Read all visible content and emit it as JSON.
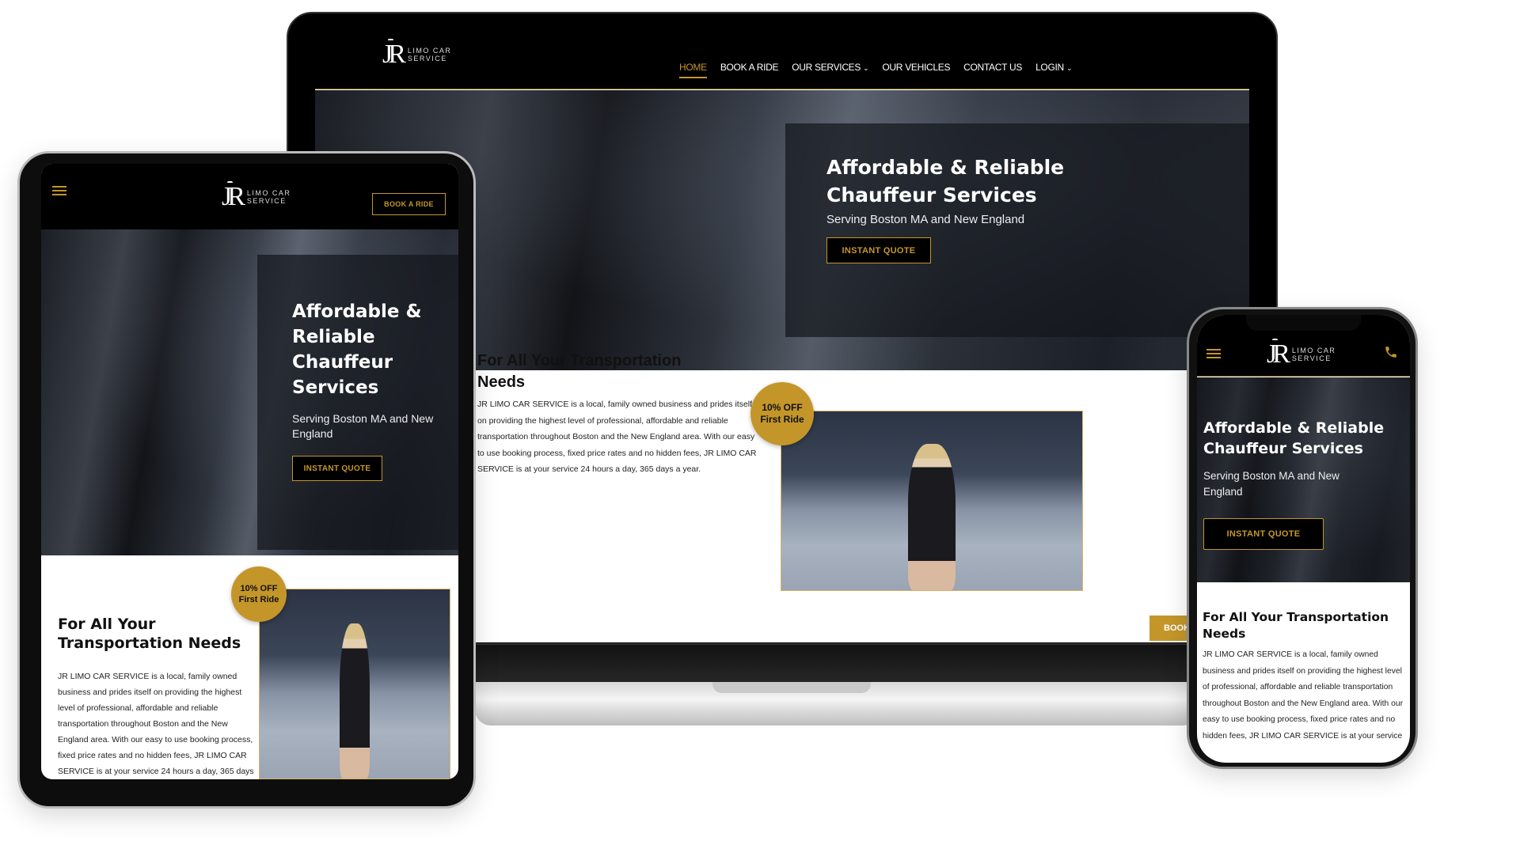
{
  "brand": {
    "initials": "JR",
    "line1": "LIMO CAR",
    "line2": "SERVICE"
  },
  "colors": {
    "accent": "#c4962a",
    "nav_bg": "#000000",
    "text": "#111111"
  },
  "desktop": {
    "nav": [
      {
        "label": "HOME",
        "active": true
      },
      {
        "label": "BOOK A RIDE"
      },
      {
        "label": "OUR SERVICES",
        "dropdown": true
      },
      {
        "label": "OUR VEHICLES"
      },
      {
        "label": "CONTACT US"
      },
      {
        "label": "LOGIN",
        "dropdown": true
      }
    ],
    "chevron": "⌄",
    "book_button": "BOOK"
  },
  "hero": {
    "title_line1": "Affordable & Reliable",
    "title_line2": "Chauffeur Services",
    "tablet_title": [
      "Affordable &",
      "Reliable",
      "Chauffeur",
      "Services"
    ],
    "subtitle": "Serving Boston MA and New England",
    "button": "INSTANT QUOTE"
  },
  "about": {
    "heading": "For All Your Transportation Needs",
    "paragraph": "JR LIMO CAR SERVICE is a local, family owned business and prides itself on providing the highest level of professional, affordable and reliable transportation throughout Boston and the New England area. With our easy to use booking process, fixed price rates and no hidden fees, JR LIMO CAR SERVICE is at your service 24 hours a day, 365 days a year.",
    "badge_line1": "10% OFF",
    "badge_line2": "First Ride"
  },
  "tablet": {
    "book_button": "BOOK A RIDE",
    "menu_icon": "hamburger-icon"
  },
  "phone": {
    "menu_icon": "hamburger-icon",
    "call_icon": "phone-icon"
  }
}
